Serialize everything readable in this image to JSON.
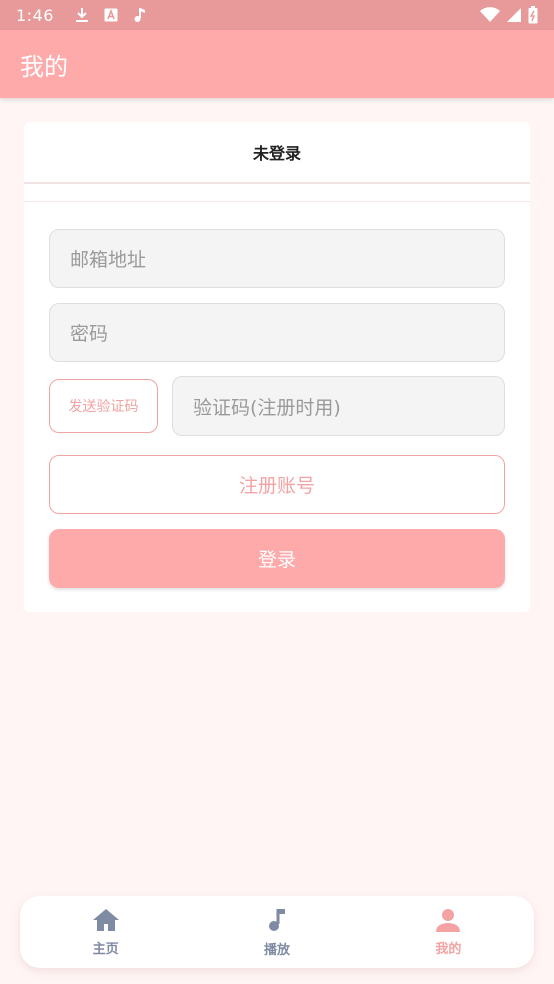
{
  "status": {
    "time": "1:46"
  },
  "app_bar": {
    "title": "我的"
  },
  "login_card": {
    "header": "未登录",
    "email": {
      "placeholder": "邮箱地址"
    },
    "password": {
      "placeholder": "密码"
    },
    "send_code_label": "发送验证码",
    "code": {
      "placeholder": "验证码(注册时用)"
    },
    "register_label": "注册账号",
    "login_label": "登录"
  },
  "bottom_nav": {
    "items": [
      {
        "label": "主页",
        "icon": "home-icon"
      },
      {
        "label": "播放",
        "icon": "music-note-icon"
      },
      {
        "label": "我的",
        "icon": "person-icon"
      }
    ],
    "active_index": 2
  },
  "colors": {
    "accent": "#ffaaaa",
    "status_bar": "#e89a9a",
    "accent_text": "#f3a3a3",
    "inactive_nav": "#7f8aa3",
    "background": "#fff5f5"
  }
}
